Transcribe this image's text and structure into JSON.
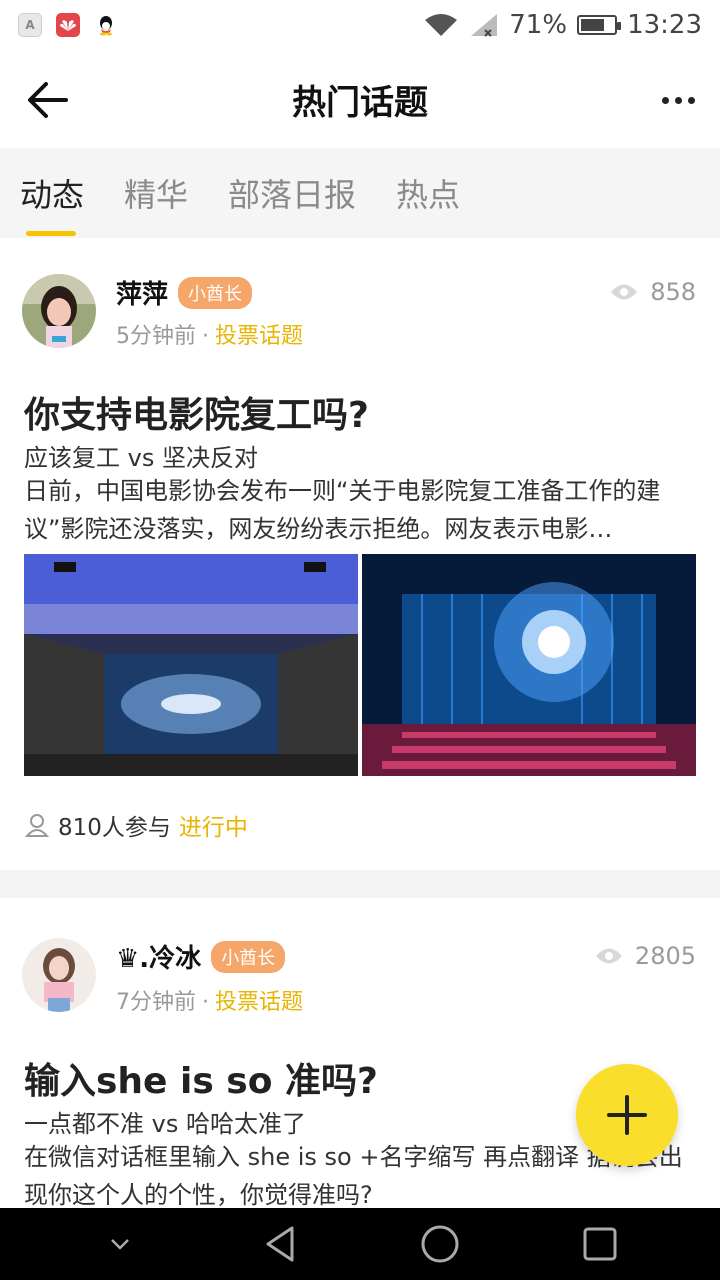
{
  "status_bar": {
    "app_icons": [
      "A",
      "华为",
      "QQ"
    ],
    "battery": "71%",
    "battery_level": 0.71,
    "time": "13:23"
  },
  "header": {
    "title": "热门话题"
  },
  "tabs": [
    {
      "label": "动态",
      "active": true
    },
    {
      "label": "精华",
      "active": false
    },
    {
      "label": "部落日报",
      "active": false
    },
    {
      "label": "热点",
      "active": false
    }
  ],
  "posts": [
    {
      "username": "萍萍",
      "badge": "小酋长",
      "time": "5分钟前",
      "dot": "·",
      "topic": "投票话题",
      "views": "858",
      "title": "你支持电影院复工吗?",
      "subtitle": "应该复工 vs 坚决反对",
      "body": "日前，中国电影协会发布一则“关于电影院复工准备工作的建议”影院还没落实，网友纷纷表示拒绝。网友表示电影…",
      "participants": "810人参与",
      "status": "进行中"
    },
    {
      "username": "♛.冷冰",
      "badge": "小酋长",
      "time": "7分钟前",
      "dot": "·",
      "topic": "投票话题",
      "views": "2805",
      "title": "输入she is so 准吗?",
      "subtitle": "一点都不准 vs 哈哈太准了",
      "body": "在微信对话框里输入 she is so +名字缩写 再点翻译 据说会出现你这个人的个性，你觉得准吗?"
    }
  ],
  "colors": {
    "accent_yellow": "#f6c400",
    "topic_yellow": "#e8b500",
    "badge_orange": "#f7a66a",
    "fab_yellow": "#f9de2b"
  }
}
